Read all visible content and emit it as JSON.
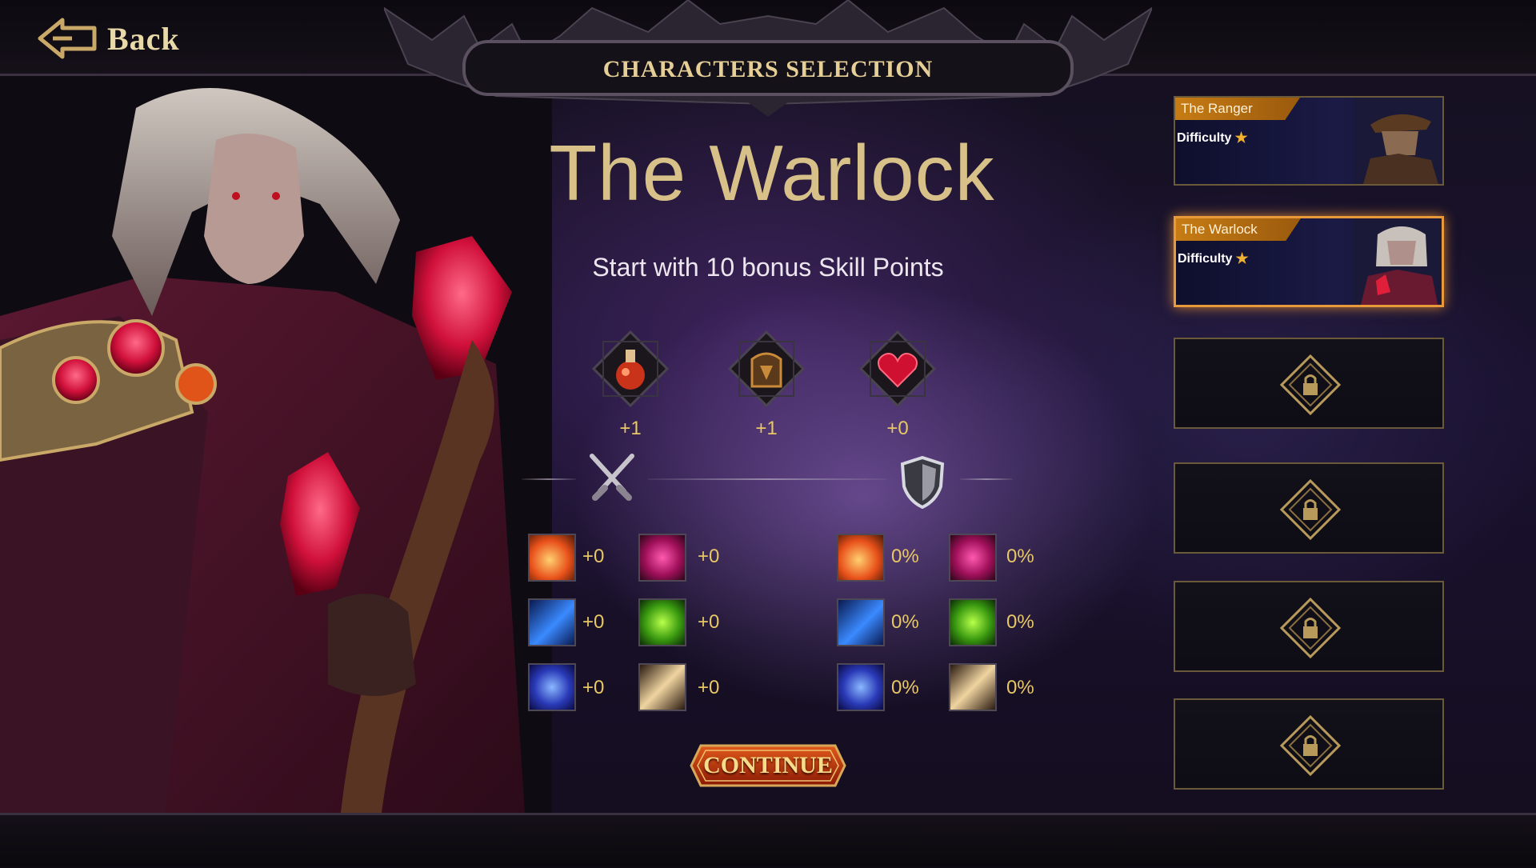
{
  "header": {
    "back_label": "Back",
    "title": "CHARACTERS SELECTION"
  },
  "character": {
    "name": "The Warlock",
    "bonus": "Start with 10 bonus Skill Points",
    "resources": [
      {
        "icon": "potion-icon",
        "value": "+1"
      },
      {
        "icon": "backpack-icon",
        "value": "+1"
      },
      {
        "icon": "heart-icon",
        "value": "+0"
      }
    ],
    "attack_stats": [
      {
        "icon": "fire-icon",
        "value": "+0"
      },
      {
        "icon": "shadow-skull-icon",
        "value": "+0"
      },
      {
        "icon": "ice-shard-icon",
        "value": "+0"
      },
      {
        "icon": "poison-skull-icon",
        "value": "+0"
      },
      {
        "icon": "lightning-icon",
        "value": "+0"
      },
      {
        "icon": "physical-slash-icon",
        "value": "+0"
      }
    ],
    "defense_stats": [
      {
        "icon": "fire-icon",
        "value": "0%"
      },
      {
        "icon": "shadow-skull-icon",
        "value": "0%"
      },
      {
        "icon": "ice-shard-icon",
        "value": "0%"
      },
      {
        "icon": "poison-skull-icon",
        "value": "0%"
      },
      {
        "icon": "lightning-icon",
        "value": "0%"
      },
      {
        "icon": "physical-slash-icon",
        "value": "0%"
      }
    ]
  },
  "continue_label": "CONTINUE",
  "roster": [
    {
      "name": "The Ranger",
      "difficulty_label": "Difficulty",
      "difficulty_stars": 1,
      "selected": false
    },
    {
      "name": "The Warlock",
      "difficulty_label": "Difficulty",
      "difficulty_stars": 1,
      "selected": true
    }
  ],
  "locked_slots": 4,
  "colors": {
    "gold_text": "#e8c765",
    "title_gold": "#d8c189",
    "selected_border": "#e89a3a",
    "tag_orange": "#c77c14"
  }
}
